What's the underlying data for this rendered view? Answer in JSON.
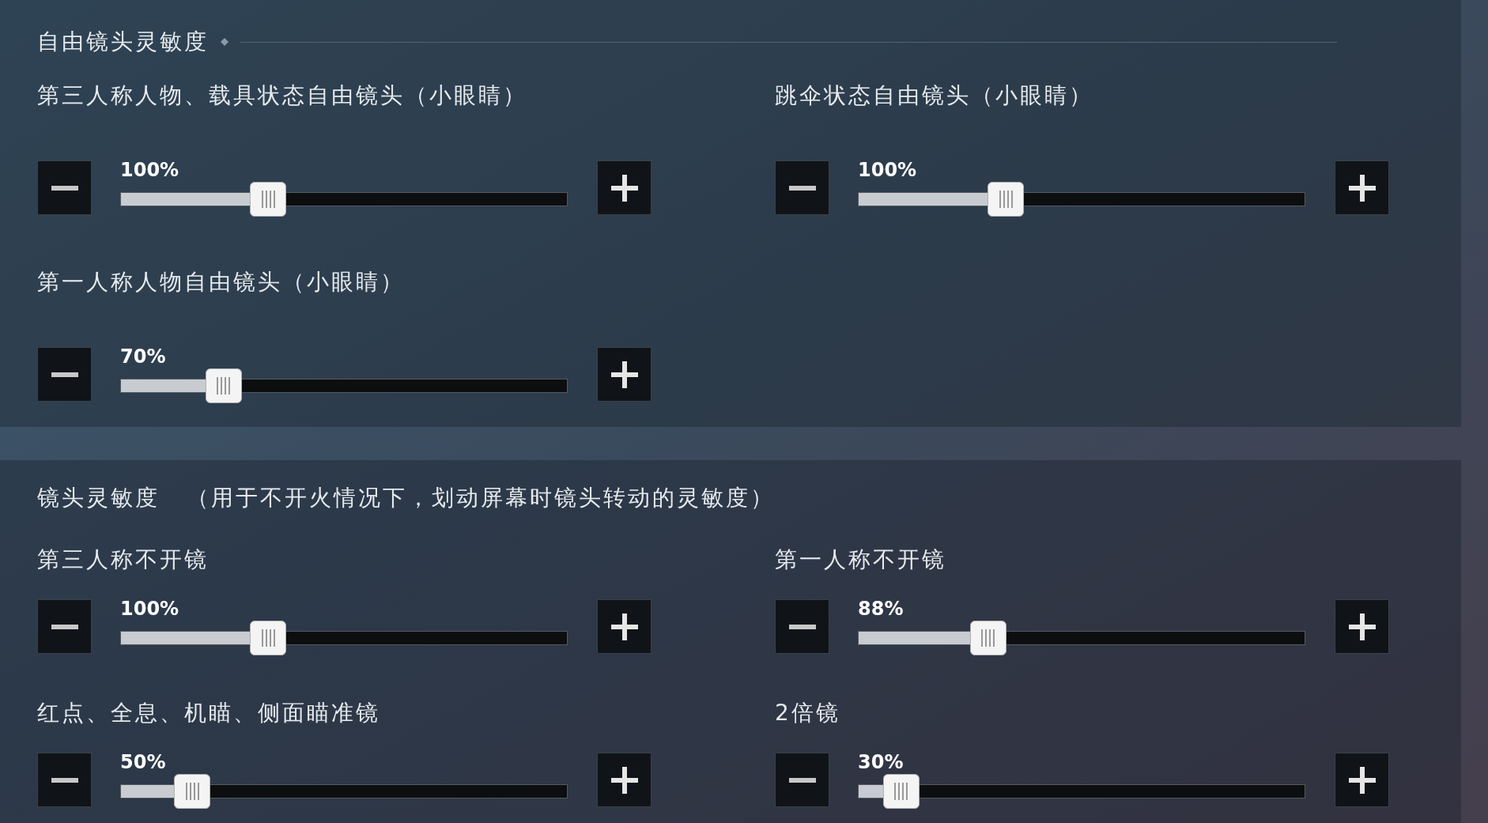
{
  "sections": [
    {
      "title": "自由镜头灵敏度",
      "items": [
        {
          "label": "第三人称人物、载具状态自由镜头（小眼睛）",
          "value": "100%",
          "level": 0.33
        },
        {
          "label": "跳伞状态自由镜头（小眼睛）",
          "value": "100%",
          "level": 0.33
        },
        {
          "label": "第一人称人物自由镜头（小眼睛）",
          "value": "70%",
          "level": 0.23
        }
      ]
    },
    {
      "title": "镜头灵敏度",
      "note": "（用于不开火情况下，划动屏幕时镜头转动的灵敏度）",
      "items": [
        {
          "label": "第三人称不开镜",
          "value": "100%",
          "level": 0.33
        },
        {
          "label": "第一人称不开镜",
          "value": "88%",
          "level": 0.29
        },
        {
          "label": "红点、全息、机瞄、侧面瞄准镜",
          "value": "50%",
          "level": 0.16
        },
        {
          "label": "2倍镜",
          "value": "30%",
          "level": 0.095
        }
      ]
    }
  ]
}
